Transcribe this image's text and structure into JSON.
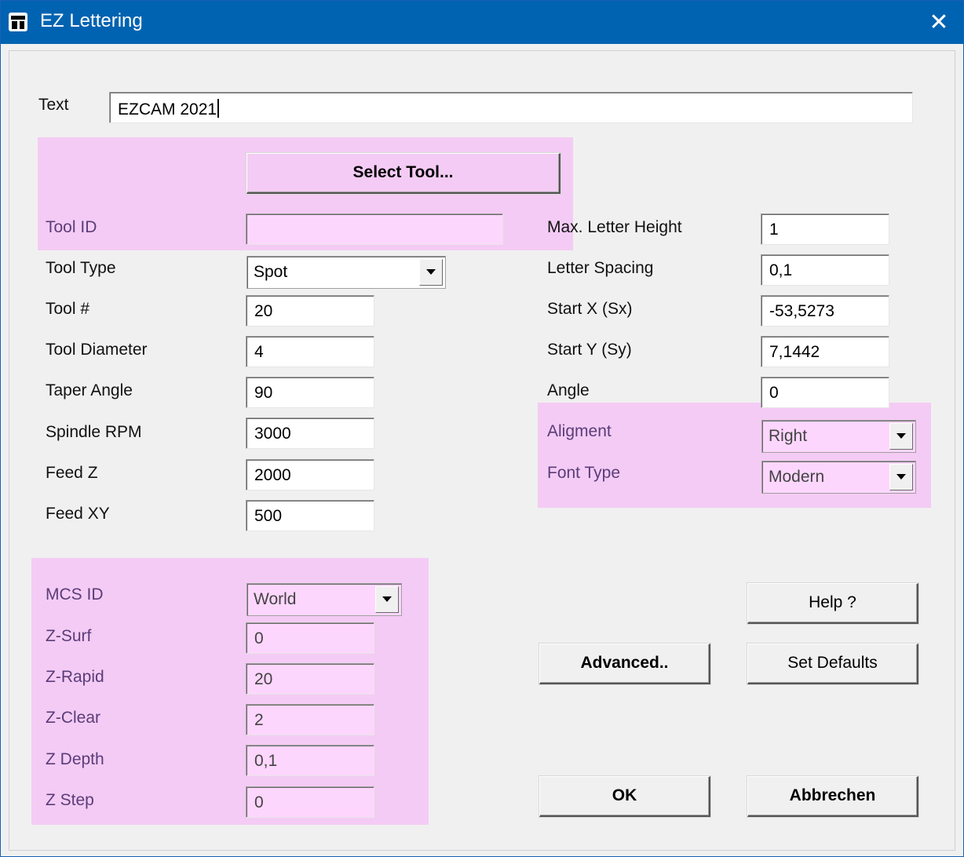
{
  "window": {
    "title": "EZ Lettering",
    "close_symbol": "✕"
  },
  "text_row": {
    "label": "Text",
    "value": "EZCAM 2021"
  },
  "tool": {
    "select_button": "Select Tool...",
    "fields": [
      {
        "label": "Tool ID",
        "value": ""
      },
      {
        "label": "Tool Type",
        "value": "Spot"
      },
      {
        "label": "Tool #",
        "value": "20"
      },
      {
        "label": "Tool Diameter",
        "value": "4"
      },
      {
        "label": "Taper Angle",
        "value": "90"
      },
      {
        "label": "Spindle RPM",
        "value": "3000"
      },
      {
        "label": "Feed Z",
        "value": "2000"
      },
      {
        "label": "Feed XY",
        "value": "500"
      }
    ]
  },
  "letter": {
    "fields": [
      {
        "label": "Max. Letter Height",
        "value": "1"
      },
      {
        "label": "Letter Spacing",
        "value": "0,1"
      },
      {
        "label": "Start X (Sx)",
        "value": "-53,5273"
      },
      {
        "label": "Start Y (Sy)",
        "value": "7,1442"
      },
      {
        "label": "Angle",
        "value": "0"
      }
    ],
    "alignment_label": "Aligment",
    "alignment_value": "Right",
    "font_label": "Font Type",
    "font_value": "Modern"
  },
  "mcs": {
    "fields": [
      {
        "label": "MCS ID",
        "value": "World"
      },
      {
        "label": "Z-Surf",
        "value": "0"
      },
      {
        "label": "Z-Rapid",
        "value": "20"
      },
      {
        "label": "Z-Clear",
        "value": "2"
      },
      {
        "label": "Z Depth",
        "value": "0,1"
      },
      {
        "label": "Z Step",
        "value": "0"
      }
    ]
  },
  "buttons": {
    "help": "Help ?",
    "advanced": "Advanced..",
    "set_defaults": "Set Defaults",
    "ok": "OK",
    "cancel": "Abbrechen"
  },
  "colors": {
    "titlebar": "#0063b1",
    "highlight": "#f4cbf4"
  }
}
